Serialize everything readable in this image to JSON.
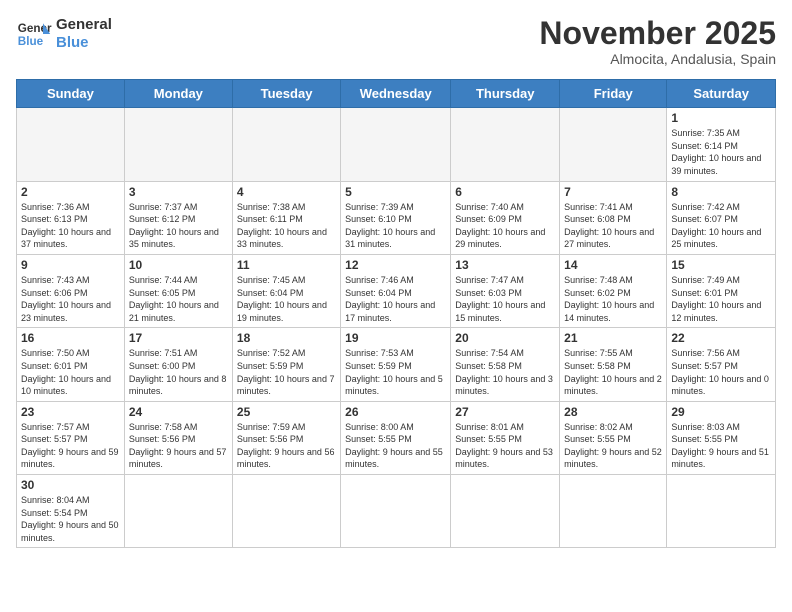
{
  "logo": {
    "text_general": "General",
    "text_blue": "Blue"
  },
  "header": {
    "title": "November 2025",
    "subtitle": "Almocita, Andalusia, Spain"
  },
  "weekdays": [
    "Sunday",
    "Monday",
    "Tuesday",
    "Wednesday",
    "Thursday",
    "Friday",
    "Saturday"
  ],
  "weeks": [
    [
      {
        "day": "",
        "info": ""
      },
      {
        "day": "",
        "info": ""
      },
      {
        "day": "",
        "info": ""
      },
      {
        "day": "",
        "info": ""
      },
      {
        "day": "",
        "info": ""
      },
      {
        "day": "",
        "info": ""
      },
      {
        "day": "1",
        "info": "Sunrise: 7:35 AM\nSunset: 6:14 PM\nDaylight: 10 hours and 39 minutes."
      }
    ],
    [
      {
        "day": "2",
        "info": "Sunrise: 7:36 AM\nSunset: 6:13 PM\nDaylight: 10 hours and 37 minutes."
      },
      {
        "day": "3",
        "info": "Sunrise: 7:37 AM\nSunset: 6:12 PM\nDaylight: 10 hours and 35 minutes."
      },
      {
        "day": "4",
        "info": "Sunrise: 7:38 AM\nSunset: 6:11 PM\nDaylight: 10 hours and 33 minutes."
      },
      {
        "day": "5",
        "info": "Sunrise: 7:39 AM\nSunset: 6:10 PM\nDaylight: 10 hours and 31 minutes."
      },
      {
        "day": "6",
        "info": "Sunrise: 7:40 AM\nSunset: 6:09 PM\nDaylight: 10 hours and 29 minutes."
      },
      {
        "day": "7",
        "info": "Sunrise: 7:41 AM\nSunset: 6:08 PM\nDaylight: 10 hours and 27 minutes."
      },
      {
        "day": "8",
        "info": "Sunrise: 7:42 AM\nSunset: 6:07 PM\nDaylight: 10 hours and 25 minutes."
      }
    ],
    [
      {
        "day": "9",
        "info": "Sunrise: 7:43 AM\nSunset: 6:06 PM\nDaylight: 10 hours and 23 minutes."
      },
      {
        "day": "10",
        "info": "Sunrise: 7:44 AM\nSunset: 6:05 PM\nDaylight: 10 hours and 21 minutes."
      },
      {
        "day": "11",
        "info": "Sunrise: 7:45 AM\nSunset: 6:04 PM\nDaylight: 10 hours and 19 minutes."
      },
      {
        "day": "12",
        "info": "Sunrise: 7:46 AM\nSunset: 6:04 PM\nDaylight: 10 hours and 17 minutes."
      },
      {
        "day": "13",
        "info": "Sunrise: 7:47 AM\nSunset: 6:03 PM\nDaylight: 10 hours and 15 minutes."
      },
      {
        "day": "14",
        "info": "Sunrise: 7:48 AM\nSunset: 6:02 PM\nDaylight: 10 hours and 14 minutes."
      },
      {
        "day": "15",
        "info": "Sunrise: 7:49 AM\nSunset: 6:01 PM\nDaylight: 10 hours and 12 minutes."
      }
    ],
    [
      {
        "day": "16",
        "info": "Sunrise: 7:50 AM\nSunset: 6:01 PM\nDaylight: 10 hours and 10 minutes."
      },
      {
        "day": "17",
        "info": "Sunrise: 7:51 AM\nSunset: 6:00 PM\nDaylight: 10 hours and 8 minutes."
      },
      {
        "day": "18",
        "info": "Sunrise: 7:52 AM\nSunset: 5:59 PM\nDaylight: 10 hours and 7 minutes."
      },
      {
        "day": "19",
        "info": "Sunrise: 7:53 AM\nSunset: 5:59 PM\nDaylight: 10 hours and 5 minutes."
      },
      {
        "day": "20",
        "info": "Sunrise: 7:54 AM\nSunset: 5:58 PM\nDaylight: 10 hours and 3 minutes."
      },
      {
        "day": "21",
        "info": "Sunrise: 7:55 AM\nSunset: 5:58 PM\nDaylight: 10 hours and 2 minutes."
      },
      {
        "day": "22",
        "info": "Sunrise: 7:56 AM\nSunset: 5:57 PM\nDaylight: 10 hours and 0 minutes."
      }
    ],
    [
      {
        "day": "23",
        "info": "Sunrise: 7:57 AM\nSunset: 5:57 PM\nDaylight: 9 hours and 59 minutes."
      },
      {
        "day": "24",
        "info": "Sunrise: 7:58 AM\nSunset: 5:56 PM\nDaylight: 9 hours and 57 minutes."
      },
      {
        "day": "25",
        "info": "Sunrise: 7:59 AM\nSunset: 5:56 PM\nDaylight: 9 hours and 56 minutes."
      },
      {
        "day": "26",
        "info": "Sunrise: 8:00 AM\nSunset: 5:55 PM\nDaylight: 9 hours and 55 minutes."
      },
      {
        "day": "27",
        "info": "Sunrise: 8:01 AM\nSunset: 5:55 PM\nDaylight: 9 hours and 53 minutes."
      },
      {
        "day": "28",
        "info": "Sunrise: 8:02 AM\nSunset: 5:55 PM\nDaylight: 9 hours and 52 minutes."
      },
      {
        "day": "29",
        "info": "Sunrise: 8:03 AM\nSunset: 5:55 PM\nDaylight: 9 hours and 51 minutes."
      }
    ],
    [
      {
        "day": "30",
        "info": "Sunrise: 8:04 AM\nSunset: 5:54 PM\nDaylight: 9 hours and 50 minutes."
      },
      {
        "day": "",
        "info": ""
      },
      {
        "day": "",
        "info": ""
      },
      {
        "day": "",
        "info": ""
      },
      {
        "day": "",
        "info": ""
      },
      {
        "day": "",
        "info": ""
      },
      {
        "day": "",
        "info": ""
      }
    ]
  ]
}
